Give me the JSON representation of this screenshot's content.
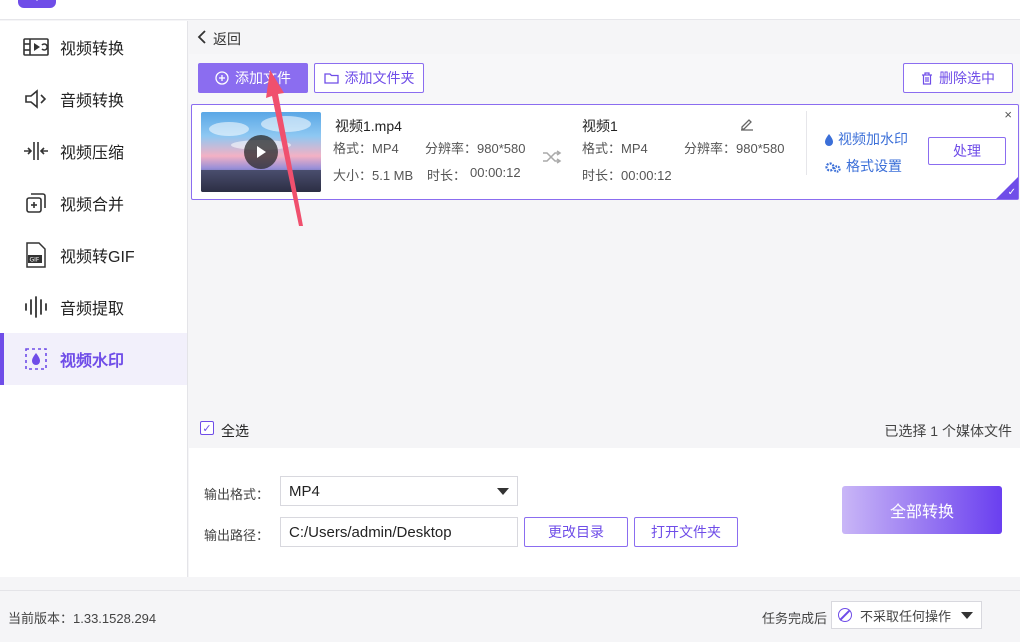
{
  "sidebar": {
    "items": [
      {
        "label": "视频转换",
        "icon": "video-convert-icon"
      },
      {
        "label": "音频转换",
        "icon": "audio-convert-icon"
      },
      {
        "label": "视频压缩",
        "icon": "video-compress-icon"
      },
      {
        "label": "视频合并",
        "icon": "video-merge-icon"
      },
      {
        "label": "视频转GIF",
        "icon": "gif-icon"
      },
      {
        "label": "音频提取",
        "icon": "audio-extract-icon"
      },
      {
        "label": "视频水印",
        "icon": "watermark-icon",
        "active": true
      }
    ]
  },
  "main": {
    "back_label": "返回",
    "toolbar": {
      "add_file": "添加文件",
      "add_folder": "添加文件夹",
      "delete_selected": "删除选中"
    },
    "file": {
      "src_name": "视频1.mp4",
      "src_format": "格式：MP4",
      "src_resolution": "分辨率：980*580",
      "src_size": "大小：5.1 MB",
      "src_duration_label": "时长：",
      "src_duration": "00:00:12",
      "dst_name": "视频1",
      "dst_format": "格式：MP4",
      "dst_resolution": "分辨率：980*580",
      "dst_duration": "时长：00:00:12",
      "watermark_link": "视频加水印",
      "format_link": "格式设置",
      "process_button": "处理",
      "close": "×"
    },
    "select_all": "全选",
    "selected_info": "已选择 1 个媒体文件",
    "output": {
      "format_label": "输出格式：",
      "format_value": "MP4",
      "path_label": "输出路径：",
      "path_value": "C:/Users/admin/Desktop",
      "change_dir": "更改目录",
      "open_folder": "打开文件夹",
      "convert_all": "全部转换"
    }
  },
  "status": {
    "version": "当前版本：1.33.1528.294",
    "after_task_label": "任务完成后",
    "after_task_value": "不采取任何操作"
  },
  "colors": {
    "accent": "#6f4de8",
    "accent_light": "#8b6df0",
    "link": "#3b6fd8",
    "annotation_arrow": "#f0506e"
  }
}
